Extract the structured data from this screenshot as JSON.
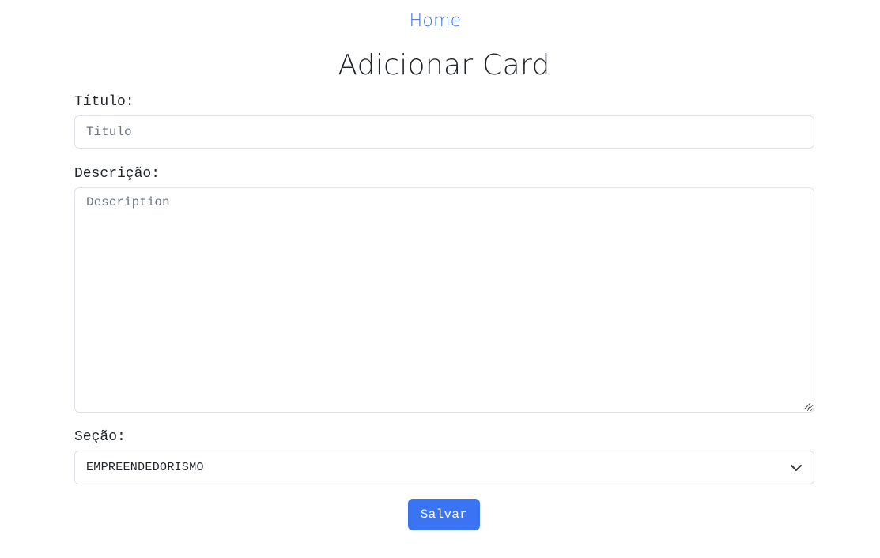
{
  "nav": {
    "home_label": "Home"
  },
  "page": {
    "title": "Adicionar Card"
  },
  "form": {
    "title_label": "Título:",
    "title_placeholder": "Titulo",
    "title_value": "",
    "description_label": "Descrição:",
    "description_placeholder": "Description",
    "description_value": "",
    "section_label": "Seção:",
    "section_selected": "EMPREENDEDORISMO",
    "save_label": "Salvar"
  },
  "icons": {
    "select_chevron": "chevron-down-icon",
    "textarea_resize": "resize-handle-icon"
  },
  "colors": {
    "link": "#3b6fe0",
    "primary_button": "#3b74f2",
    "border": "#dee2e6",
    "text": "#212529"
  }
}
